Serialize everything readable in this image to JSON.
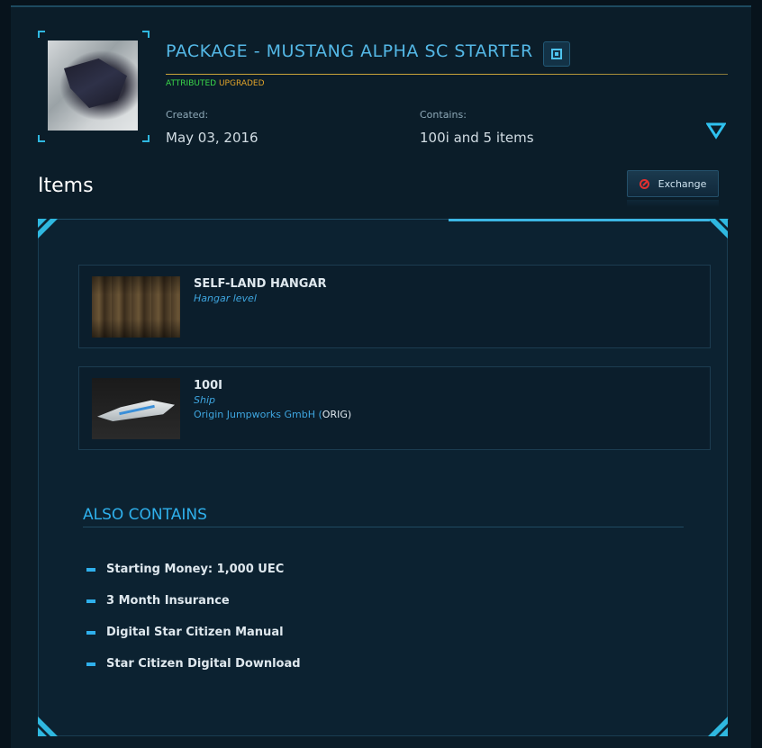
{
  "package": {
    "title": "PACKAGE - MUSTANG ALPHA SC STARTER",
    "badge_attributed": "ATTRIBUTED",
    "badge_upgraded": "UPGRADED",
    "created_label": "Created:",
    "created_value": "May 03, 2016",
    "contains_label": "Contains:",
    "contains_value": "100i and 5 items",
    "icons": {
      "chip": "chip-icon",
      "expand": "chevron-down-icon"
    }
  },
  "items_section": {
    "heading": "Items",
    "exchange_label": "Exchange",
    "exchange_icon": "ban-icon"
  },
  "items": [
    {
      "name": "SELF-LAND HANGAR",
      "kind": "Hangar level",
      "manufacturer": "",
      "manufacturer_code": ""
    },
    {
      "name": "100I",
      "kind": "Ship",
      "manufacturer": "Origin Jumpworks GmbH (",
      "manufacturer_code": "ORIG",
      "manufacturer_close": ")"
    }
  ],
  "also_contains": {
    "heading": "ALSO CONTAINS",
    "items": [
      "Starting Money: 1,000 UEC",
      "3 Month Insurance",
      "Digital Star Citizen Manual",
      "Star Citizen Digital Download"
    ]
  },
  "colors": {
    "accent": "#2fb0ec",
    "title": "#54b8e6",
    "attributed": "#3ad94a",
    "upgraded": "#e0a32a",
    "background": "#07131c",
    "panel": "#0c2231"
  }
}
